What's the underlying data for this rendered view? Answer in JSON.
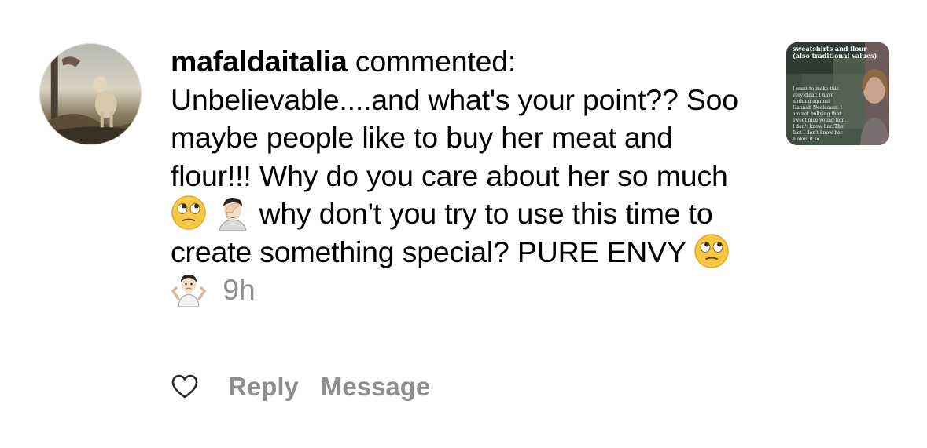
{
  "comment": {
    "username": "mafaldaitalia",
    "action": "commented:",
    "text_part1": "Unbelievable....and what's your point?? Soo maybe people like to buy her meat and flour!!! Why do you care about her so much",
    "text_part2": "why don't you try to use this time to create something special? PURE ENVY",
    "emojis": [
      "face-with-rolling-eyes",
      "person-facepalming",
      "face-with-rolling-eyes",
      "person-shrugging"
    ],
    "timestamp": "9h"
  },
  "actions": {
    "like_icon": "heart-outline-icon",
    "reply_label": "Reply",
    "message_label": "Message"
  },
  "thumbnail": {
    "caption_top": "sweatshirts and flour (also traditional values)",
    "caption_body": "I want to make this very clear. I have nothing against Hannah Neeleman. I am not bullying that sweet nice young fam. I don't know her. The fact I don't know her makes it so interesting. I never thought I would be s"
  },
  "colors": {
    "text": "#000000",
    "secondary_text": "#8e8e8e",
    "background": "#ffffff"
  }
}
